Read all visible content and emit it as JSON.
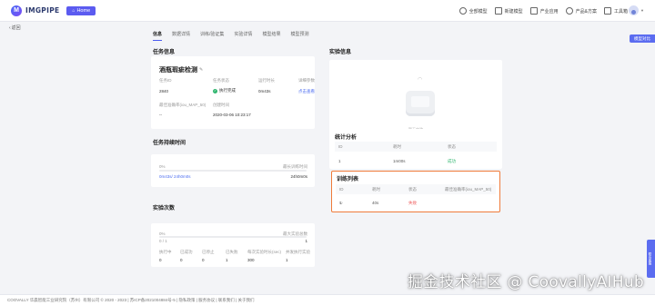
{
  "brand": {
    "logo_letter": "M",
    "name": "IMGPIPE"
  },
  "header": {
    "home_label": "Home",
    "nav": [
      {
        "label": "全部模型",
        "icon": "grid-icon"
      },
      {
        "label": "新建模型",
        "icon": "plus-square-icon"
      },
      {
        "label": "产业应用",
        "icon": "factory-icon"
      },
      {
        "label": "产品&方案",
        "icon": "location-icon"
      },
      {
        "label": "工具箱",
        "icon": "toolbox-icon"
      }
    ]
  },
  "back_label": "返回",
  "tabs": [
    "信息",
    "数据详情",
    "训练/验证集",
    "实验详情",
    "模型结果",
    "模型预测"
  ],
  "side_button": "模型对比",
  "task_info": {
    "title": "任务信息",
    "name": "酒瓶瑕疵检测",
    "fields": [
      {
        "label": "任务ID",
        "value": "2840"
      },
      {
        "label": "任务状态",
        "value": "执行完成"
      },
      {
        "label": "运行时长",
        "value": "0m43s"
      },
      {
        "label": "详细参数",
        "value": "点击查看"
      },
      {
        "label": "最佳准确率(iou_MAP_50)",
        "value": "--"
      },
      {
        "label": "创建时间",
        "value": "2020-03-06 10:23:17"
      }
    ]
  },
  "experiment_info": {
    "title": "实验信息",
    "caption": "暂无实验"
  },
  "stats": {
    "title": "统计分析",
    "headers": [
      "ID",
      "耗时",
      "状态"
    ],
    "rows": [
      {
        "id": "1",
        "time": "1m00s",
        "status": "成功"
      }
    ]
  },
  "training_list": {
    "title": "训练列表",
    "headers": [
      "ID",
      "耗时",
      "状态",
      "最佳准确率(iou_MAP_50)"
    ],
    "rows": [
      {
        "id": "1",
        "time": "40s",
        "status": "失败",
        "best": ""
      }
    ]
  },
  "task_duration": {
    "title": "任务持续时间",
    "progress_label": "0%",
    "max_label": "最长训练时间",
    "left_value": "0m43s/ 24h0m0s",
    "right_value": "24h0m0s",
    "progress": 0.0
  },
  "experiment_count": {
    "title": "实验次数",
    "progress_label": "0%",
    "max_label": "最大实验总数",
    "used": "0 / 1",
    "max": "1",
    "columns": [
      {
        "label": "执行中",
        "value": "0"
      },
      {
        "label": "已成功",
        "value": "0"
      },
      {
        "label": "已停止",
        "value": "0"
      },
      {
        "label": "已失败",
        "value": "1"
      },
      {
        "label": "每次实验时长(sec)",
        "value": "300"
      },
      {
        "label": "并发执行实验",
        "value": "1"
      }
    ],
    "progress": 0.0
  },
  "footer": "COOVALLY 华晨智能工业研究院（苏州）有限公司 © 2020 - 2023 | 苏ICP备2021004884号-5 | 隐私政策 | 服务协议 | 联系我们 | 关于我们",
  "watermark": "掘金技术社区 @ CoovallyAIHub",
  "side_tool": "联系客服"
}
